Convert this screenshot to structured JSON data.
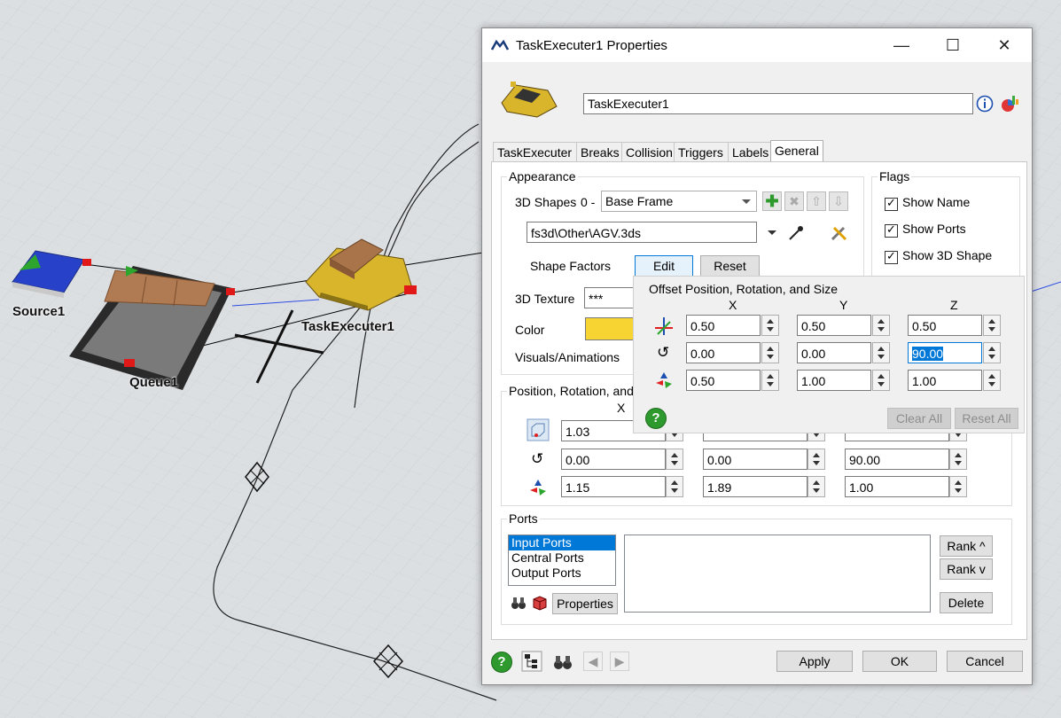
{
  "scene": {
    "objects": [
      {
        "name": "source",
        "label": "Source1"
      },
      {
        "name": "queue",
        "label": "Queue1"
      },
      {
        "name": "task-executer",
        "label": "TaskExecuter1"
      }
    ]
  },
  "window": {
    "title": "TaskExecuter1  Properties",
    "minimize": "—",
    "maximize": "☐",
    "close": "✕"
  },
  "object_name": "TaskExecuter1",
  "tabs": [
    "TaskExecuter",
    "Breaks",
    "Collision",
    "Triggers",
    "Labels",
    "General"
  ],
  "active_tab": "General",
  "appearance": {
    "title": "Appearance",
    "shapes_label": "3D Shapes",
    "shapes_index": "0 -",
    "shape_selected": "Base Frame",
    "shape_file": "fs3d\\Other\\AGV.3ds",
    "shape_factors_label": "Shape Factors",
    "edit_label": "Edit",
    "reset_label": "Reset",
    "texture_label": "3D Texture",
    "texture_value": "***",
    "color_label": "Color",
    "color_value": "#f7d431",
    "visuals_label": "Visuals/Animations"
  },
  "flags": {
    "title": "Flags",
    "items": [
      {
        "label": "Show Name",
        "checked": true
      },
      {
        "label": "Show Ports",
        "checked": true
      },
      {
        "label": "Show 3D Shape",
        "checked": true
      }
    ]
  },
  "offset_popup": {
    "title": "Offset Position, Rotation, and Size",
    "headers": [
      "X",
      "Y",
      "Z"
    ],
    "rows": [
      {
        "icon": "position-axes-icon",
        "values": [
          "0.50",
          "0.50",
          "0.50"
        ]
      },
      {
        "icon": "rotation-icon",
        "values": [
          "0.00",
          "0.00",
          "90.00"
        ]
      },
      {
        "icon": "size-axes-icon",
        "values": [
          "0.50",
          "1.00",
          "1.00"
        ]
      }
    ],
    "clear_all": "Clear All",
    "reset_all": "Reset All"
  },
  "position": {
    "title": "Position, Rotation, and",
    "header_x": "X",
    "rows": [
      {
        "icon": "position-cube-icon",
        "values": [
          "1.03",
          "",
          ""
        ]
      },
      {
        "icon": "rotation-icon",
        "values": [
          "0.00",
          "0.00",
          "90.00"
        ]
      },
      {
        "icon": "size-axes-icon",
        "values": [
          "1.15",
          "1.89",
          "1.00"
        ]
      }
    ]
  },
  "ports": {
    "title": "Ports",
    "list": [
      "Input Ports",
      "Central Ports",
      "Output Ports"
    ],
    "selected": "Input Ports",
    "properties_label": "Properties",
    "rank_up": "Rank ^",
    "rank_down": "Rank v",
    "delete": "Delete"
  },
  "footer": {
    "apply": "Apply",
    "ok": "OK",
    "cancel": "Cancel"
  },
  "colors": {
    "accent": "#0078d7",
    "help_green": "#2e9a2e",
    "object_yellow": "#f7d431"
  }
}
